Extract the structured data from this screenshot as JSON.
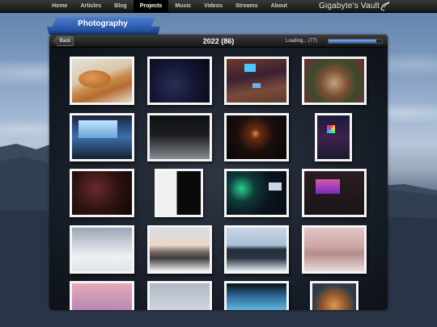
{
  "nav": {
    "items": [
      {
        "label": "Home",
        "active": false
      },
      {
        "label": "Articles",
        "active": false
      },
      {
        "label": "Blog",
        "active": false
      },
      {
        "label": "Projects",
        "active": true
      },
      {
        "label": "Music",
        "active": false
      },
      {
        "label": "Videos",
        "active": false
      },
      {
        "label": "Streams",
        "active": false
      },
      {
        "label": "About",
        "active": false
      }
    ],
    "site_title": "Gigabyte's Vault"
  },
  "section": {
    "title": "Photography"
  },
  "panel": {
    "back_label": "Back",
    "title": "2022 (86)",
    "loading_text": "Loading... (77)",
    "progress_fraction": 0.9
  },
  "photos": [
    {
      "name": "photo-sleeping-cat",
      "style": "p-cat"
    },
    {
      "name": "photo-dark-room",
      "style": "p-dark1"
    },
    {
      "name": "photo-desk-setup",
      "style": "p-room1"
    },
    {
      "name": "photo-christmas-tree",
      "style": "p-tree"
    },
    {
      "name": "photo-monitor-wall",
      "style": "p-monitor"
    },
    {
      "name": "photo-dark-floor",
      "style": "p-floor"
    },
    {
      "name": "photo-orange-lamp",
      "style": "p-lamp"
    },
    {
      "name": "photo-colorful-logo",
      "style": "p-colorful"
    },
    {
      "name": "photo-red-screen",
      "style": "p-red"
    },
    {
      "name": "photo-black-white-sticker",
      "style": "p-sticker"
    },
    {
      "name": "photo-neon-lights",
      "style": "p-neon"
    },
    {
      "name": "photo-purple-tv",
      "style": "p-tv"
    },
    {
      "name": "photo-snowy-ground",
      "style": "p-snow1"
    },
    {
      "name": "photo-mountain-view",
      "style": "p-mtn"
    },
    {
      "name": "photo-snowy-forest",
      "style": "p-forest"
    },
    {
      "name": "photo-snow-fence",
      "style": "p-snowfence"
    },
    {
      "name": "photo-pink-sunset",
      "style": "p-sunset"
    },
    {
      "name": "photo-frozen-lake",
      "style": "p-lake"
    },
    {
      "name": "photo-blue-screen",
      "style": "p-screen2"
    },
    {
      "name": "photo-orange-cat",
      "style": "p-cat2"
    }
  ]
}
